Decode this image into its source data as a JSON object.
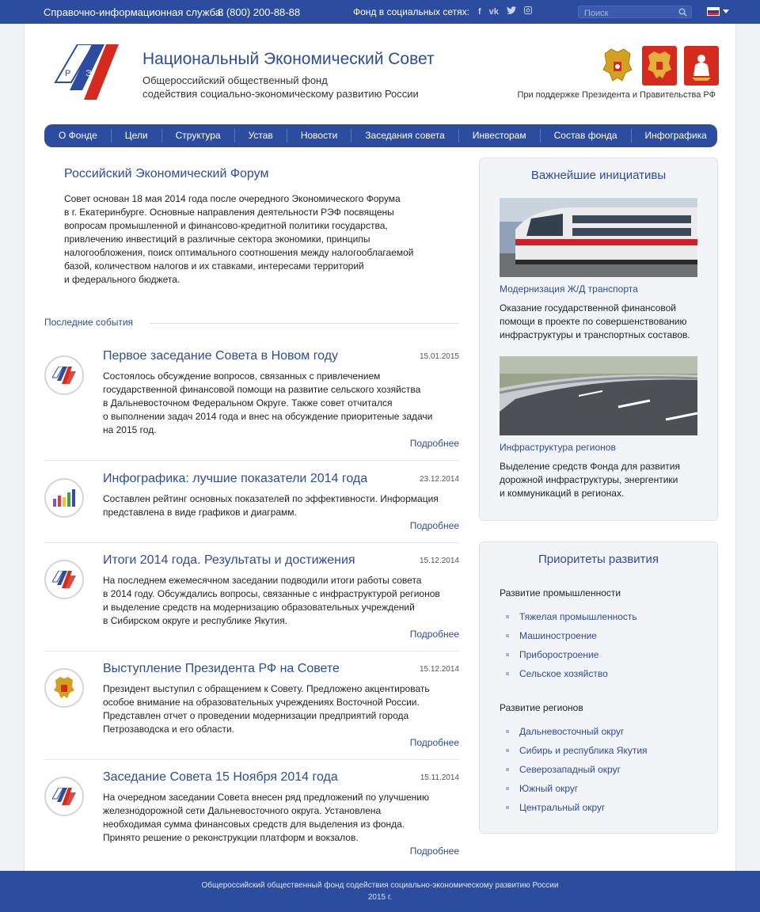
{
  "topbar": {
    "phone_label": "Справочно-информационная служба:",
    "phone_number": "8 (800) 200-88-88",
    "social_label": "Фонд в социальных сетях:",
    "social_icons": [
      "f",
      "vk",
      "tw",
      "ig"
    ],
    "search_placeholder": "Поиск",
    "flag_colors": [
      "#ffffff",
      "#1c3fa8",
      "#d52b1e"
    ]
  },
  "header": {
    "logo_letters": [
      "Р",
      "Э",
      "Ф"
    ],
    "title": "Национальный Экономический Совет",
    "subtitle_line1": "Общероссийский общественный фонд",
    "subtitle_line2": "содействия социально-экономическому развитию России",
    "support_text": "При поддержке Президента и Правительства РФ",
    "emblems": [
      "russia-coat-of-arms-icon",
      "red-emblem-icon",
      "moscow-coat-of-arms-icon"
    ]
  },
  "nav": [
    {
      "label": "О Фонде"
    },
    {
      "label": "Цели"
    },
    {
      "label": "Структура"
    },
    {
      "label": "Устав"
    },
    {
      "label": "Новости"
    },
    {
      "label": "Заседания совета"
    },
    {
      "label": "Инвесторам"
    },
    {
      "label": "Состав фонда"
    },
    {
      "label": "Инфографика"
    }
  ],
  "about": {
    "title": "Российский Экономический Форум",
    "lines": [
      "Совет основан 18 мая 2014 года после очередного Экономического Форума",
      "в г. Екатеринбурге. Основные направления деятельности РЭФ посвящены",
      "вопросам промышленной и финансово-кредитной политики государства,",
      "привлечению инвестиций в различные сектора экономики, принципы",
      "налогообложения, поиск оптимального соотношения между налогооблагаемой",
      "базой, количеством налогов и их ставками, интересами территорий",
      "и федерального бюджета."
    ]
  },
  "events": {
    "heading": "Последние события",
    "more_label": "Подробнее",
    "items": [
      {
        "icon": "ref-logo-icon",
        "title": "Первое заседание Совета в Новом году",
        "date": "15.01.2015",
        "lines": [
          "Состоялось обсуждение вопросов, связанных с привлечением",
          "государственной финансовой помощи на развитие сельского хозяйства",
          "в Дальневосточном Федеральном Округе. Также совет отчитался",
          "о выполнении задач 2014 года и внес на обсуждение приоритеные задачи",
          "на 2015 год."
        ]
      },
      {
        "icon": "bar-chart-icon",
        "title": "Инфографика: лучшие показатели 2014 года",
        "date": "23.12.2014",
        "lines": [
          "Составлен рейтинг основных показателей по эффективности. Информация",
          "представлена в виде графиков и диаграмм."
        ]
      },
      {
        "icon": "ref-logo-icon",
        "title": "Итоги 2014 года. Результаты и достижения",
        "date": "15.12.2014",
        "lines": [
          "На последнем ежемесячном заседании подводили итоги работы совета",
          "в 2014 году. Обсуждались вопросы, связанные с инфраструктурой регионов",
          "и выделение средств на модернизацию образовательных учреждений",
          "в Сибирском округе и республике Якутия."
        ]
      },
      {
        "icon": "coat-of-arms-icon",
        "title": "Выступление Президента РФ на Совете",
        "date": "15.12.2014",
        "lines": [
          "Президент выступил с обращением к Совету. Предложено акцентировать",
          "особое внимание на образовательных учреждениях Восточной России.",
          "Представлен отчет о проведении модернизации предприятий города",
          "Петрозаводска и его области."
        ]
      },
      {
        "icon": "ref-logo-icon",
        "title": "Заседание Совета 15 Ноября 2014 года",
        "date": "15.11.2014",
        "lines": [
          "На очередном заседании Совета внесен ряд предложений по улучшению",
          "железнодорожной сети Дальневосточного округа. Установлена",
          "необходимая сумма финансовых средств для выделения из фонда.",
          "Принято решение о реконструкции платформ и вокзалов."
        ]
      }
    ]
  },
  "initiatives": {
    "title": "Важнейшие инициативы",
    "items": [
      {
        "image": "train-photo",
        "link": "Модернизация Ж/Д транспорта",
        "lines": [
          "Оказание государственной финансовой",
          "помощи в проекте по совершенствованию",
          "инфраструктуры и транспортных составов."
        ]
      },
      {
        "image": "road-photo",
        "link": "Инфраструктура регионов",
        "lines": [
          "Выделение средств Фонда для развития",
          "дорожной инфраструктуры, энергентики",
          "и коммуникаций в регионах."
        ]
      }
    ]
  },
  "priorities": {
    "title": "Приоритеты развития",
    "groups": [
      {
        "label": "Развитие промышленности",
        "items": [
          "Тяжелая промышленность",
          "Машиностроение",
          "Приборостроение",
          "Сельское хозяйство"
        ]
      },
      {
        "label": "Развитие регионов",
        "items": [
          "Дальневосточный округ",
          "Сибирь и республика Якутия",
          "Северозападный округ",
          "Южный округ",
          "Центральный округ"
        ]
      }
    ]
  },
  "footer": {
    "line1": "Общероссийский общественный фонд содействия социально-экономическому развитию России",
    "line2": "2015 г."
  }
}
